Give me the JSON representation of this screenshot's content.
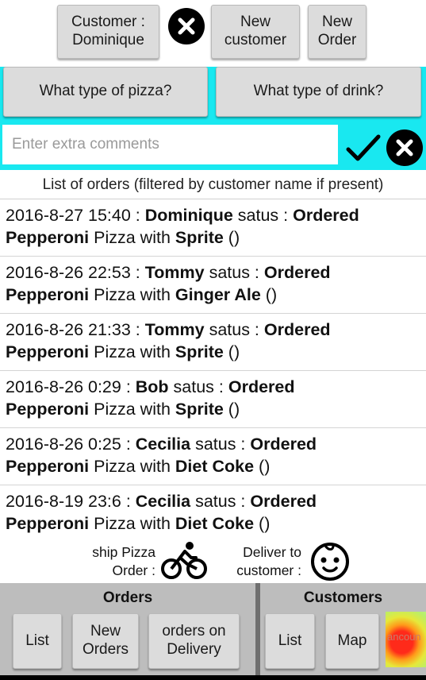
{
  "topbar": {
    "customer_label": "Customer :\nDominique",
    "clear_icon": "close-circle-icon",
    "new_customer_label": "New\ncustomer",
    "new_order_label": "New\nOrder"
  },
  "order_form": {
    "pizza_button": "What type of pizza?",
    "drink_button": "What type of drink?",
    "comments_placeholder": "Enter extra comments",
    "comments_value": "",
    "confirm_icon": "checkmark-icon",
    "cancel_icon": "close-circle-icon",
    "panel_color": "#19e8f0"
  },
  "orders": {
    "title": "List of orders (filtered by customer name if present)",
    "rows": [
      {
        "datetime": "2016-8-27 15:40",
        "customer": "Dominique",
        "status": "Ordered",
        "pizza": "Pepperoni",
        "drink": "Sprite",
        "extra": "()"
      },
      {
        "datetime": "2016-8-26 22:53",
        "customer": "Tommy",
        "status": "Ordered",
        "pizza": "Pepperoni",
        "drink": "Ginger Ale",
        "extra": "()"
      },
      {
        "datetime": "2016-8-26 21:33",
        "customer": "Tommy",
        "status": "Ordered",
        "pizza": "Pepperoni",
        "drink": "Sprite",
        "extra": "()"
      },
      {
        "datetime": "2016-8-26 0:29",
        "customer": "Bob",
        "status": "Ordered",
        "pizza": "Pepperoni",
        "drink": "Sprite",
        "extra": "()"
      },
      {
        "datetime": "2016-8-26 0:25",
        "customer": "Cecilia",
        "status": "Ordered",
        "pizza": "Pepperoni",
        "drink": "Diet Coke",
        "extra": "()"
      },
      {
        "datetime": "2016-8-19 23:6",
        "customer": "Cecilia",
        "status": "Ordered",
        "pizza": "Pepperoni",
        "drink": "Diet Coke",
        "extra": "()"
      }
    ]
  },
  "delivery": {
    "ship_label": "ship Pizza\nOrder :",
    "ship_icon": "bicycle-icon",
    "deliver_label": "Deliver to\ncustomer :",
    "deliver_icon": "baby-face-icon"
  },
  "bottom": {
    "orders_title": "Orders",
    "orders_list": "List",
    "new_orders": "New\nOrders",
    "on_delivery": "orders on\nDelivery",
    "customers_title": "Customers",
    "customers_list": "List",
    "customers_map": "Map",
    "heatmap_text": "ancoun"
  }
}
